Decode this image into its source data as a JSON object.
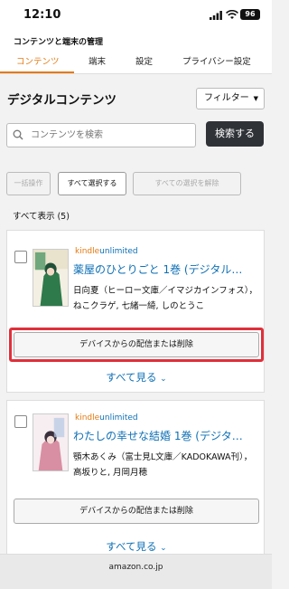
{
  "status_bar": {
    "time": "12:10",
    "battery": "96"
  },
  "header": {
    "title": "コンテンツと端末の管理",
    "tabs": [
      {
        "label": "コンテンツ",
        "active": true
      },
      {
        "label": "端末",
        "active": false
      },
      {
        "label": "設定",
        "active": false
      },
      {
        "label": "プライバシー設定",
        "active": false
      }
    ]
  },
  "section": {
    "title": "デジタルコンテンツ",
    "filter_label": "フィルター"
  },
  "search": {
    "placeholder": "コンテンツを検索",
    "button_label": "検索する"
  },
  "actions": {
    "bulk": "一括操作",
    "select_all": "すべて選択する",
    "deselect_all": "すべての選択を解除"
  },
  "show_all": "すべて表示 (5)",
  "books": [
    {
      "ku_kindle": "kindle",
      "ku_unlimited": "unlimited",
      "title": "薬屋のひとりごと 1巻 (デジタル…",
      "author": "日向夏（ヒーロー文庫／イマジカインフォス），ねこクラゲ, 七緒一綺, しのとうこ",
      "deliver_label": "デバイスからの配信または削除",
      "see_all": "すべて見る"
    },
    {
      "ku_kindle": "kindle",
      "ku_unlimited": "unlimited",
      "title": "わたしの幸せな結婚 1巻 (デジタ…",
      "author": "顎木あくみ（富士見L文庫／KADOKAWA刊），高坂りと, 月岡月穂",
      "deliver_label": "デバイスからの配信または削除",
      "see_all": "すべて見る"
    }
  ],
  "bottom_bar": {
    "url": "amazon.co.jp"
  },
  "colors": {
    "accent": "#e47911",
    "link": "#0e70b5",
    "highlight": "#e0303a"
  }
}
